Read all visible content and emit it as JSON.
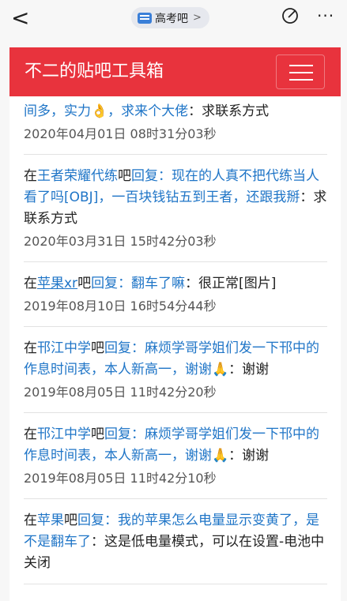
{
  "topbar": {
    "back": "<",
    "forum_pill": "高考吧",
    "pill_chevron": ">",
    "more": "···"
  },
  "header": {
    "title": "不二的贴吧工具箱"
  },
  "posts": [
    {
      "text_a": "间多，实力👌，求来个大佬",
      "text_b": "：求联系方式",
      "date": "2020年04月01日 08时31分03秒"
    },
    {
      "prefix": "在",
      "forum": "王者荣耀代练",
      "ba": "吧",
      "reply": "回复",
      "title": "：现在的人真不把代练当人看了吗[OBJ]，一百块钱钻五到王者，还跟我掰",
      "colon_text": "：求联系方式",
      "date": "2020年03月31日 15时42分03秒"
    },
    {
      "prefix": "在",
      "forum": "苹果xr",
      "ba": "吧",
      "reply": "回复",
      "title": "：翻车了嘛",
      "colon_text": "：很正常[图片]",
      "date": "2019年08月10日 16时54分44秒"
    },
    {
      "prefix": "在",
      "forum": "邗江中学",
      "ba": "吧",
      "reply": "回复",
      "title": "：麻烦学哥学姐们发一下邗中的作息时间表，本人新高一，谢谢🙏",
      "colon_text": "：谢谢",
      "date": "2019年08月05日 11时42分20秒"
    },
    {
      "prefix": "在",
      "forum": "邗江中学",
      "ba": "吧",
      "reply": "回复",
      "title": "：麻烦学哥学姐们发一下邗中的作息时间表，本人新高一，谢谢🙏",
      "colon_text": "：谢谢",
      "date": "2019年08月05日 11时42分10秒"
    },
    {
      "prefix": "在",
      "forum": "苹果",
      "ba": "吧",
      "reply": "回复",
      "title": "：我的苹果怎么电量显示变黄了，是不是翻车了",
      "colon_text": "：这是低电量模式，可以在设置-电池中关闭",
      "date": ""
    }
  ]
}
